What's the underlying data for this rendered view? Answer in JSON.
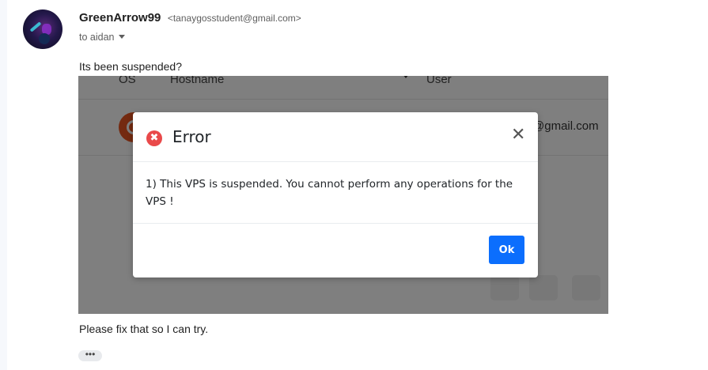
{
  "message": {
    "sender_name": "GreenArrow99",
    "sender_email": "<tanaygosstudent@gmail.com>",
    "to_label": "to aidan",
    "body_line1": "Its been suspended?",
    "body_line2": "Please fix that so I can try.",
    "more_label": "•••"
  },
  "screenshot": {
    "columns": [
      "OS",
      "Hostname",
      "User"
    ],
    "row_email_fragment": "@gmail.com",
    "dialog": {
      "title": "Error",
      "error_glyph": "✖",
      "close_glyph": "✕",
      "message": "1) This VPS is suspended. You cannot perform any operations for the VPS !",
      "ok_label": "Ok",
      "accent_color": "#0b6efd",
      "error_color": "#e9494a"
    }
  },
  "icons": {
    "avatar": "avatar-image",
    "caret": "chevron-down-icon",
    "os_logo": "ubuntu-logo-icon",
    "error": "error-circle-icon",
    "close": "close-icon"
  }
}
